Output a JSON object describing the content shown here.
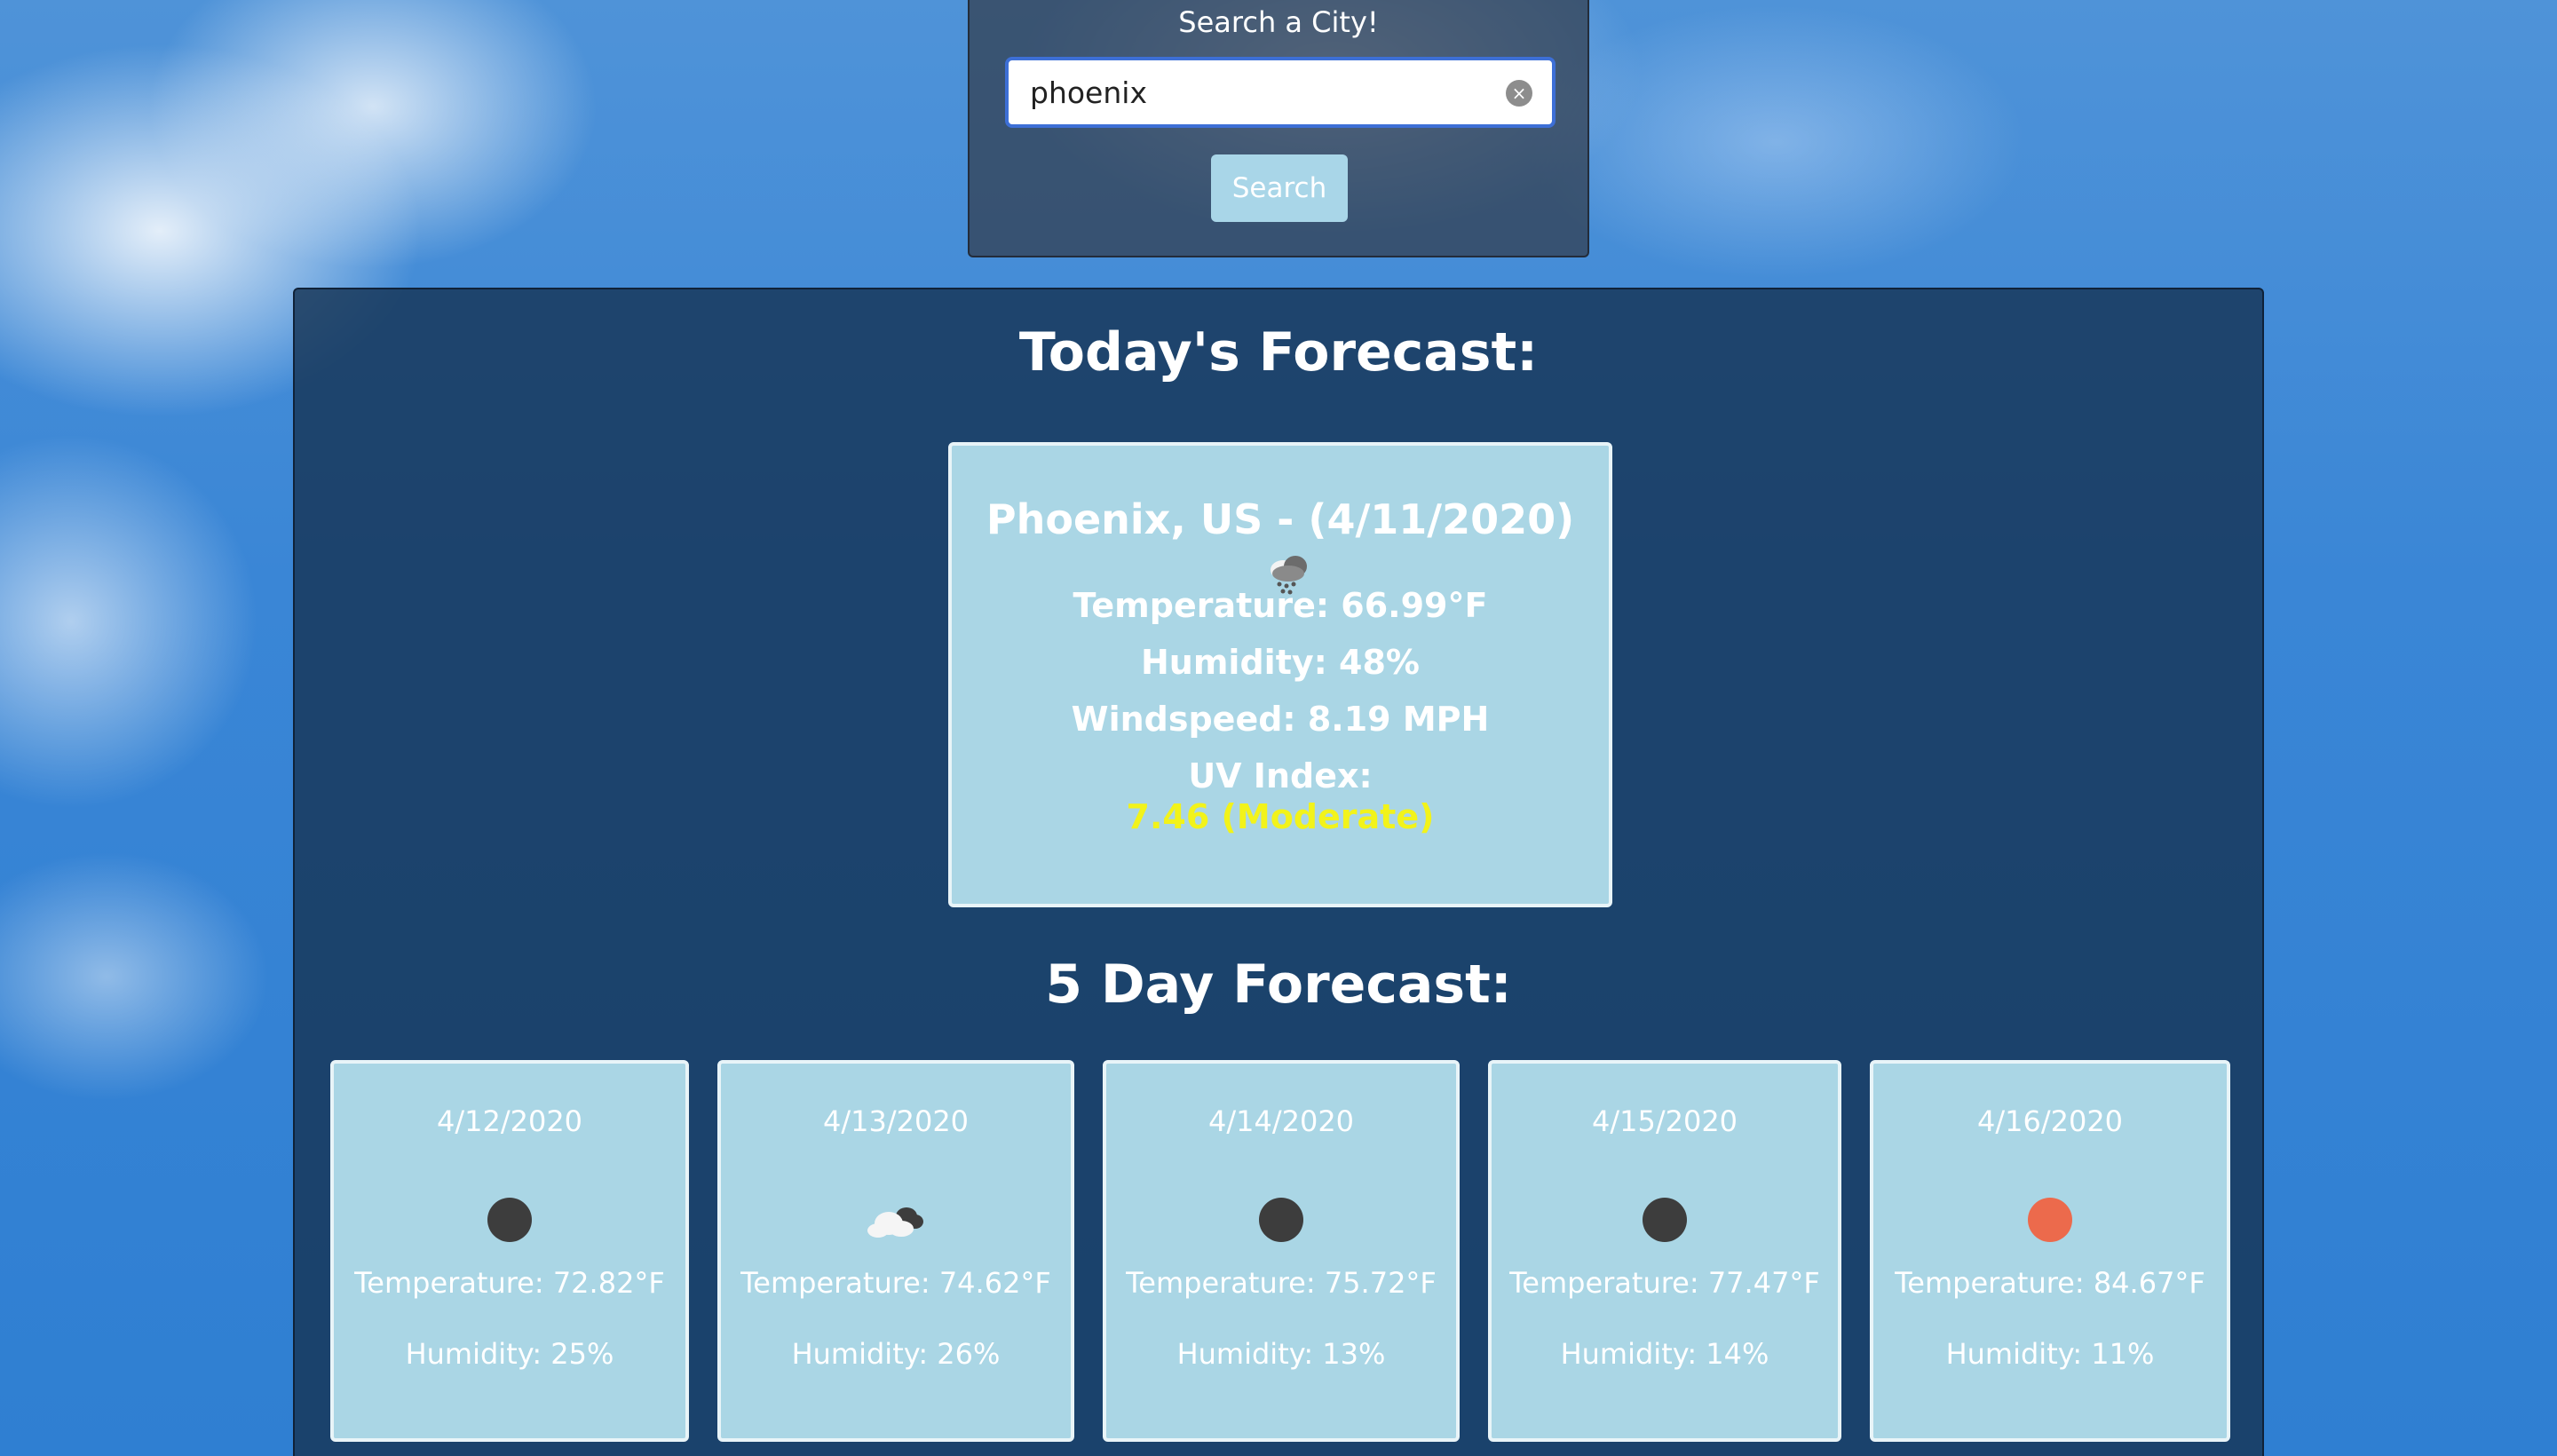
{
  "search": {
    "title": "Search a City!",
    "value": "phoenix",
    "clear_icon": "clear-icon",
    "button_label": "Search"
  },
  "today": {
    "heading": "Today's Forecast:",
    "city_line": "Phoenix, US - (4/11/2020)",
    "icon": "rain-cloud-icon",
    "temperature": "Temperature: 66.99°F",
    "humidity": "Humidity: 48%",
    "windspeed": "Windspeed: 8.19 MPH",
    "uv_label": "UV Index:",
    "uv_value": "7.46 (Moderate)",
    "uv_color": "#f2f31a"
  },
  "five_day": {
    "heading": "5 Day Forecast:",
    "days": [
      {
        "date": "4/12/2020",
        "icon": "dark-circle-icon",
        "temperature": "Temperature: 72.82°F",
        "humidity": "Humidity: 25%"
      },
      {
        "date": "4/13/2020",
        "icon": "cloud-icon",
        "temperature": "Temperature: 74.62°F",
        "humidity": "Humidity: 26%"
      },
      {
        "date": "4/14/2020",
        "icon": "dark-circle-icon",
        "temperature": "Temperature: 75.72°F",
        "humidity": "Humidity: 13%"
      },
      {
        "date": "4/15/2020",
        "icon": "dark-circle-icon",
        "temperature": "Temperature: 77.47°F",
        "humidity": "Humidity: 14%"
      },
      {
        "date": "4/16/2020",
        "icon": "sun-icon",
        "temperature": "Temperature: 84.67°F",
        "humidity": "Humidity: 11%"
      }
    ]
  },
  "colors": {
    "card_bg": "#aad6e5",
    "panel_bg": "#163456",
    "sun": "#ec6a4c",
    "dark_circle": "#3d3d3d"
  }
}
